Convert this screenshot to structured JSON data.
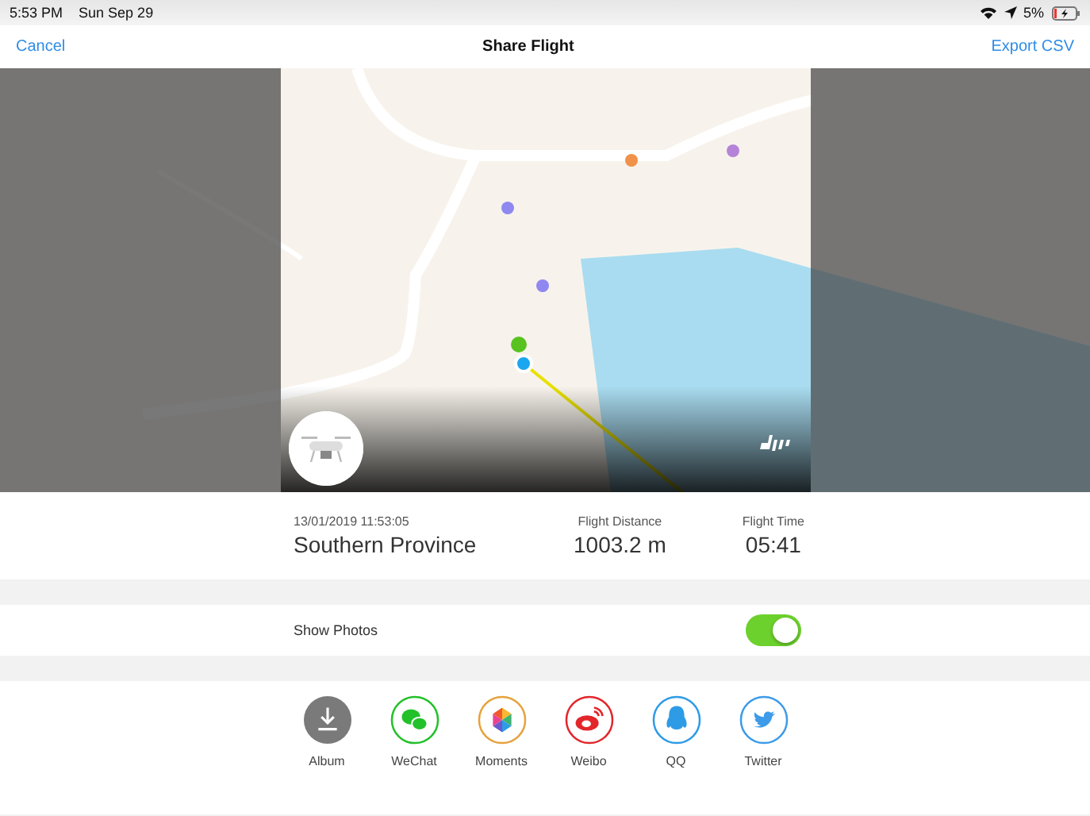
{
  "status_bar": {
    "time": "5:53 PM",
    "date": "Sun Sep 29",
    "battery": "5%"
  },
  "nav": {
    "left": "Cancel",
    "title": "Share Flight",
    "right": "Export CSV"
  },
  "flight": {
    "datetime": "13/01/2019 11:53:05",
    "place": "Southern Province",
    "stats": [
      {
        "label": "Flight Distance",
        "value": "1003.2 m"
      },
      {
        "label": "Flight Time",
        "value": "05:41"
      }
    ]
  },
  "show_photos": {
    "label": "Show Photos",
    "on": true
  },
  "share": [
    {
      "kind": "album",
      "label": "Album"
    },
    {
      "kind": "wechat",
      "label": "WeChat"
    },
    {
      "kind": "moments",
      "label": "Moments"
    },
    {
      "kind": "weibo",
      "label": "Weibo"
    },
    {
      "kind": "qq",
      "label": "QQ"
    },
    {
      "kind": "twitter",
      "label": "Twitter"
    }
  ]
}
